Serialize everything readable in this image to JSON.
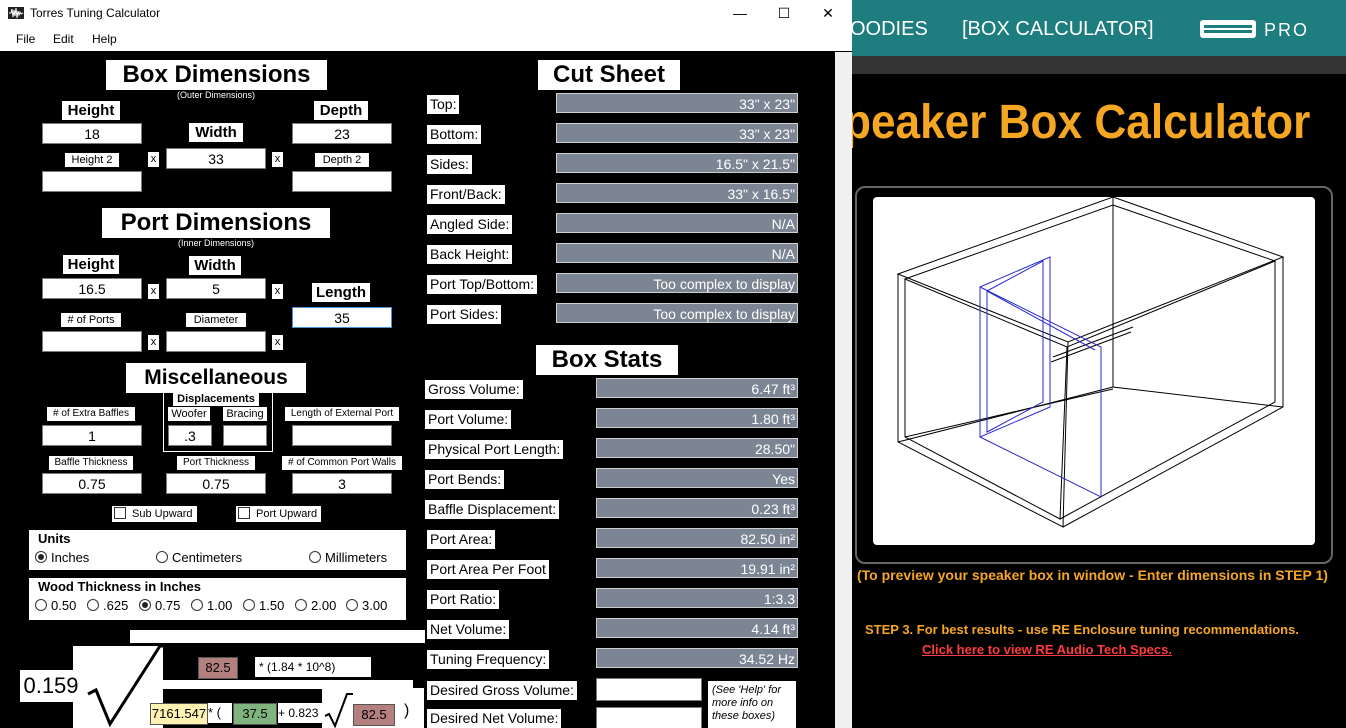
{
  "window": {
    "title": "Torres Tuning Calculator",
    "minimize": "—",
    "maximize": "☐",
    "close": "✕"
  },
  "menu": [
    "File",
    "Edit",
    "Help"
  ],
  "box_dimensions": {
    "title": "Box Dimensions",
    "subtitle": "(Outer Dimensions)",
    "height_label": "Height",
    "height_value": "18",
    "width_label": "Width",
    "width_value": "33",
    "depth_label": "Depth",
    "depth_value": "23",
    "height2_label": "Height 2",
    "height2_value": "",
    "depth2_label": "Depth 2",
    "depth2_value": "",
    "x": "x"
  },
  "port_dimensions": {
    "title": "Port Dimensions",
    "subtitle": "(Inner Dimensions)",
    "height_label": "Height",
    "height_value": "16.5",
    "width_label": "Width",
    "width_value": "5",
    "length_label": "Length",
    "length_value": "35",
    "ports_label": "# of Ports",
    "ports_value": "",
    "diameter_label": "Diameter",
    "diameter_value": ""
  },
  "misc": {
    "title": "Miscellaneous",
    "extra_baffles_label": "# of Extra Baffles",
    "extra_baffles_value": "1",
    "displacements_label": "Displacements",
    "woofer_label": "Woofer",
    "woofer_value": ".3",
    "bracing_label": "Bracing",
    "bracing_value": "",
    "ext_port_label": "Length of External Port",
    "ext_port_value": "",
    "baffle_thickness_label": "Baffle Thickness",
    "baffle_thickness_value": "0.75",
    "port_thickness_label": "Port Thickness",
    "port_thickness_value": "0.75",
    "common_walls_label": "# of Common Port Walls",
    "common_walls_value": "3",
    "sub_upward": "Sub Upward",
    "port_upward": "Port Upward"
  },
  "units": {
    "title": "Units",
    "options": [
      "Inches",
      "Centimeters",
      "Millimeters"
    ],
    "selected": "Inches"
  },
  "wood": {
    "title": "Wood Thickness in Inches",
    "options": [
      "0.50",
      ".625",
      "0.75",
      "1.00",
      "1.50",
      "2.00",
      "3.00"
    ],
    "selected": "0.75"
  },
  "formula": {
    "coef": "0.159",
    "v1": "82.5",
    "t1": "* (1.84 * 10^8)",
    "v2": "7161.547",
    "t2": "* (",
    "v3": "37.5",
    "t3": "+ 0.823",
    "v4": "82.5",
    "t4": ")"
  },
  "cut_sheet": {
    "title": "Cut Sheet",
    "rows": [
      {
        "label": "Top:",
        "value": "33\" x 23\""
      },
      {
        "label": "Bottom:",
        "value": "33\" x 23\""
      },
      {
        "label": "Sides:",
        "value": "16.5\" x 21.5\""
      },
      {
        "label": "Front/Back:",
        "value": "33\" x 16.5\""
      },
      {
        "label": "Angled Side:",
        "value": "N/A"
      },
      {
        "label": "Back Height:",
        "value": "N/A"
      },
      {
        "label": "Port Top/Bottom:",
        "value": "Too complex to display"
      },
      {
        "label": "Port Sides:",
        "value": "Too complex to display"
      }
    ]
  },
  "box_stats": {
    "title": "Box Stats",
    "rows": [
      {
        "label": "Gross Volume:",
        "value": "6.47 ft³"
      },
      {
        "label": "Port Volume:",
        "value": "1.80 ft³"
      },
      {
        "label": "Physical Port Length:",
        "value": "28.50\""
      },
      {
        "label": "Port Bends:",
        "value": "Yes"
      },
      {
        "label": "Baffle Displacement:",
        "value": "0.23 ft³"
      },
      {
        "label": "Port Area:",
        "value": "82.50 in²"
      },
      {
        "label": "Port Area Per Foot",
        "value": "19.91 in²"
      },
      {
        "label": "Port Ratio:",
        "value": "1:3.3"
      },
      {
        "label": "Net Volume:",
        "value": "4.14 ft³"
      },
      {
        "label": "Tuning Frequency:",
        "value": "34.52 Hz"
      }
    ],
    "desired_gross_label": "Desired Gross Volume:",
    "desired_gross_value": "",
    "desired_net_label": "Desired Net Volume:",
    "desired_net_value": "",
    "help_note": "(See 'Help' for more info on these boxes)"
  },
  "site": {
    "nav_left": "OODIES",
    "nav_center": "[BOX CALCULATOR]",
    "logo": "RE PRO",
    "heading": "peaker Box Calculator",
    "preview_note": "(To preview your speaker box in window - Enter dimensions in STEP 1)",
    "step3": "STEP 3.  For best results - use RE Enclosure tuning recommendations.",
    "specs_link": "Click here to view RE Audio Tech Specs."
  },
  "colors": {
    "site_header": "#1e7d7e",
    "site_orange": "#f5a623",
    "site_link": "#ff3b3b",
    "value_box": "#7b8593",
    "formula_red": "#b47f7f",
    "formula_green": "#7fb47f",
    "formula_yellow": "#fff2b3"
  }
}
